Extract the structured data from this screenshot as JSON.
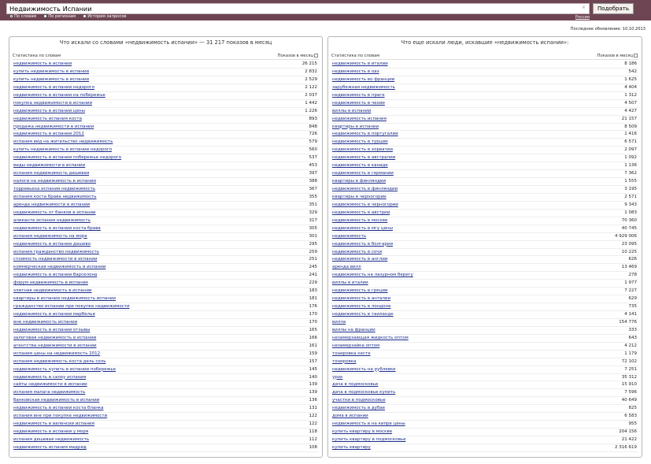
{
  "search": {
    "query": "Недвижимость Испании",
    "clear_glyph": "×",
    "submit_label": "Подобрать",
    "region_label": "Россия",
    "modes": [
      {
        "label": "По словам",
        "selected": true
      },
      {
        "label": "По регионам",
        "selected": false
      },
      {
        "label": "История запросов",
        "selected": false
      }
    ]
  },
  "updated": "Последнее обновление: 10.10.2013",
  "left": {
    "title": "Что искали со словами «недвижимость испании» — 31 217 показов в месяц",
    "col1": "Статистика по словам",
    "col2": "Показов в месяц",
    "rows": [
      [
        "недвижимость в испании",
        "26 215"
      ],
      [
        "купить недвижимость в испании",
        "2 832"
      ],
      [
        "купить недвижимость в испании",
        "2 529"
      ],
      [
        "недвижимость в испании недорого",
        "2 122"
      ],
      [
        "недвижимость в испании на побережье",
        "2 037"
      ],
      [
        "покупка недвижимости в испании",
        "1 442"
      ],
      [
        "недвижимость в испании цены",
        "1 226"
      ],
      [
        "недвижимость испания коста",
        "893"
      ],
      [
        "продажа недвижимости в испании",
        "848"
      ],
      [
        "недвижимость в испании 2012",
        "726"
      ],
      [
        "испания вид на жительство недвижимость",
        "579"
      ],
      [
        "купить недвижимость в испании недорого",
        "560"
      ],
      [
        "недвижимость в испании побережье недорого",
        "537"
      ],
      [
        "виды недвижимости в испании",
        "453"
      ],
      [
        "испания недвижимость дешевая",
        "397"
      ],
      [
        "налоги на недвижимость в испании",
        "388"
      ],
      [
        "торревьеха испания недвижимость",
        "367"
      ],
      [
        "испания коста брава недвижимость",
        "355"
      ],
      [
        "аренда недвижимости в испании",
        "351"
      ],
      [
        "недвижимость от банков в испании",
        "329"
      ],
      [
        "аликанте испания недвижимость",
        "317"
      ],
      [
        "недвижимость в испании коста брава",
        "305"
      ],
      [
        "испания недвижимость на море",
        "301"
      ],
      [
        "недвижимость в испании дешево",
        "295"
      ],
      [
        "испания гражданство недвижимость",
        "259"
      ],
      [
        "стоимость недвижимости в испании",
        "251"
      ],
      [
        "коммерческая недвижимость в испании",
        "245"
      ],
      [
        "недвижимость в испании барселона",
        "241"
      ],
      [
        "форум недвижимость в испании",
        "229"
      ],
      [
        "элитная недвижимость в испании",
        "183"
      ],
      [
        "квартиры в испании недвижимость испании",
        "181"
      ],
      [
        "гражданство испании при покупке недвижимости",
        "176"
      ],
      [
        "недвижимость в испании марбелья",
        "170"
      ],
      [
        "вне недвижимость испании",
        "170"
      ],
      [
        "недвижимость в испании отзывы",
        "165"
      ],
      [
        "залоговая недвижимость в испании",
        "166"
      ],
      [
        "агентства недвижимости в испании",
        "161"
      ],
      [
        "испания цены на недвижимость 2012",
        "159"
      ],
      [
        "испания недвижимость коста дель соль",
        "157"
      ],
      [
        "недвижимость купить в испании побережье",
        "145"
      ],
      [
        "недвижимость в салоу испания",
        "140"
      ],
      [
        "сайты недвижимости в испании",
        "139"
      ],
      [
        "испания малага недвижимость",
        "139"
      ],
      [
        "банковская недвижимость в испании",
        "136"
      ],
      [
        "недвижимость в испании коста бланка",
        "131"
      ],
      [
        "испания вне при покупке недвижимости",
        "122"
      ],
      [
        "недвижимость в валенсии испания",
        "122"
      ],
      [
        "недвижимость в испании у моря",
        "118"
      ],
      [
        "испания дешевая недвижимость",
        "112"
      ],
      [
        "недвижимость испания мадрид",
        "108"
      ]
    ]
  },
  "right": {
    "title": "Что еще искали люди, искавшие «недвижимость испании»:",
    "col1": "Статистика по словам",
    "col2": "Показов в месяц",
    "rows": [
      [
        "недвижимость в италии",
        "8 186"
      ],
      [
        "недвижимость в оаэ",
        "542"
      ],
      [
        "недвижимость во франции",
        "1 625"
      ],
      [
        "зарубежная недвижимость",
        "4 404"
      ],
      [
        "недвижимость в праге",
        "1 312"
      ],
      [
        "недвижимость в чехии",
        "4 507"
      ],
      [
        "виллы в испании",
        "4 427"
      ],
      [
        "недвижимость испания",
        "21 157"
      ],
      [
        "квартиры в испании",
        "8 509"
      ],
      [
        "недвижимость в португалии",
        "1 416"
      ],
      [
        "недвижимость в турции",
        "6 571"
      ],
      [
        "недвижимость в хорватии",
        "2 097"
      ],
      [
        "недвижимость в австралии",
        "1 092"
      ],
      [
        "недвижимость в канаде",
        "1 136"
      ],
      [
        "недвижимость в германии",
        "7 362"
      ],
      [
        "квартиры в финляндии",
        "1 555"
      ],
      [
        "недвижимость в финляндии",
        "3 195"
      ],
      [
        "квартиры в черногории",
        "2 571"
      ],
      [
        "недвижимость в черногории",
        "9 343"
      ],
      [
        "недвижимость в австрии",
        "1 083"
      ],
      [
        "недвижимость в москве",
        "70 360"
      ],
      [
        "недвижимость в мгу цены",
        "40 745"
      ],
      [
        "недвижимость",
        "4 929 006"
      ],
      [
        "недвижимость в болгарии",
        "23 095"
      ],
      [
        "недвижимость в сочи",
        "10 225"
      ],
      [
        "недвижимость в англии",
        "626"
      ],
      [
        "аренда вилл",
        "13 469"
      ],
      [
        "недвижимость на лазурном берегу",
        "278"
      ],
      [
        "виллы в италии",
        "1 977"
      ],
      [
        "недвижимость в греции",
        "7 227"
      ],
      [
        "недвижимость в анталии",
        "629"
      ],
      [
        "недвижимость в лондоне",
        "735"
      ],
      [
        "недвижимость в таиланде",
        "4 141"
      ],
      [
        "вилла",
        "154 776"
      ],
      [
        "виллы на франции",
        "333"
      ],
      [
        "незамерзающая жидкость оптом",
        "643"
      ],
      [
        "незамерзайка оптом",
        "4 212"
      ],
      [
        "тонировка кесте",
        "1 179"
      ],
      [
        "тонировка",
        "72 102"
      ],
      [
        "недвижимость на рублевке",
        "7 251"
      ],
      [
        "урок",
        "35 312"
      ],
      [
        "дача в подмосковье",
        "15 910"
      ],
      [
        "дача в подмосковье купить",
        "7 596"
      ],
      [
        "участки в подмосковье",
        "40 649"
      ],
      [
        "недвижимость в дубае",
        "825"
      ],
      [
        "дома в испании",
        "6 583"
      ],
      [
        "недвижимость в на кипре цены",
        "955"
      ],
      [
        "купить квартиру в москве",
        "204 156"
      ],
      [
        "купить квартиру в подмосковье",
        "21 422"
      ],
      [
        "купить квартиру",
        "2 316 619"
      ]
    ]
  }
}
